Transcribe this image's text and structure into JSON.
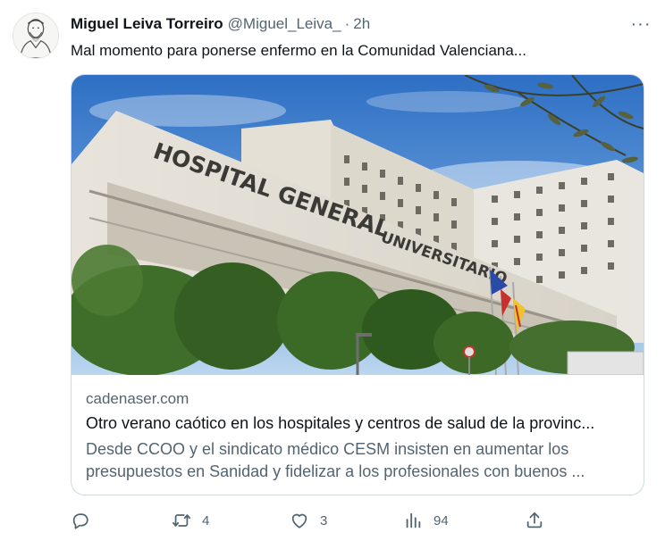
{
  "author": {
    "display_name": "Miguel Leiva Torreiro",
    "handle": "@Miguel_Leiva_",
    "separator": "·",
    "time": "2h",
    "avatar_icon": "sketch-portrait-avatar"
  },
  "more_icon": "more-options-icon",
  "more_label": "···",
  "tweet_text": "Mal momento para ponerse enfermo en la Comunidad Valenciana...",
  "card": {
    "image_sign_line1": "HOSPITAL GENERAL",
    "image_sign_line2": "UNIVERSITARIO",
    "domain": "cadenaser.com",
    "title": "Otro verano caótico en los hospitales y centros de salud de la provinc...",
    "description_line1": "Desde CCOO y el sindicato médico CESM insisten en aumentar los",
    "description_line2": "presupuestos en Sanidad y fidelizar a los profesionales con buenos ..."
  },
  "actions": {
    "reply": {
      "icon": "reply-icon",
      "count": ""
    },
    "retweet": {
      "icon": "retweet-icon",
      "count": "4"
    },
    "like": {
      "icon": "heart-icon",
      "count": "3"
    },
    "views": {
      "icon": "views-icon",
      "count": "94"
    },
    "share": {
      "icon": "share-icon",
      "count": ""
    }
  },
  "colors": {
    "text_primary": "#0f1419",
    "text_secondary": "#536471",
    "border": "#cfd9de",
    "sky": "#4a86d1"
  }
}
